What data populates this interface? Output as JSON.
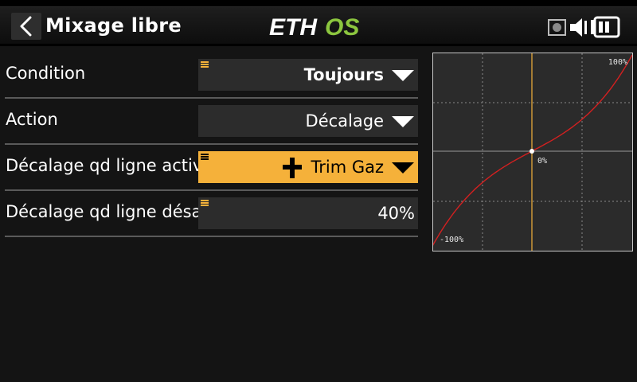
{
  "header": {
    "title": "Mixage libre",
    "logo": {
      "text_left": "ETH",
      "text_right": "OS",
      "color_left": "#ffffff",
      "color_right": "#8cc63f"
    },
    "icons": [
      "back-chevron-icon",
      "sd-card-icon",
      "speaker-icon",
      "battery-icon"
    ]
  },
  "rows": [
    {
      "label": "Condition",
      "value": "Toujours",
      "editable_marker": true,
      "dropdown": true,
      "active": false
    },
    {
      "label": "Action",
      "value": "Décalage",
      "editable_marker": false,
      "dropdown": true,
      "active": false
    },
    {
      "label": "Décalage qd ligne activée",
      "value": "Trim Gaz",
      "value_icon": "trim-cross-icon",
      "editable_marker": true,
      "dropdown": true,
      "active": true
    },
    {
      "label": "Décalage qd ligne désactivée",
      "value": "40%",
      "editable_marker": true,
      "dropdown": false,
      "active": false
    }
  ],
  "graph": {
    "label_top_right": "100%",
    "label_center": "0%",
    "label_bottom_left": "-100%",
    "x_range": [
      -100,
      100
    ],
    "y_range": [
      -100,
      100
    ],
    "curve_color": "#d42020",
    "cursor_color": "#f5b13a",
    "cursor_x": 0,
    "cursor_y": 0
  },
  "colors": {
    "accent": "#f5b13a",
    "background": "#141414",
    "field": "#2c2c2c"
  }
}
